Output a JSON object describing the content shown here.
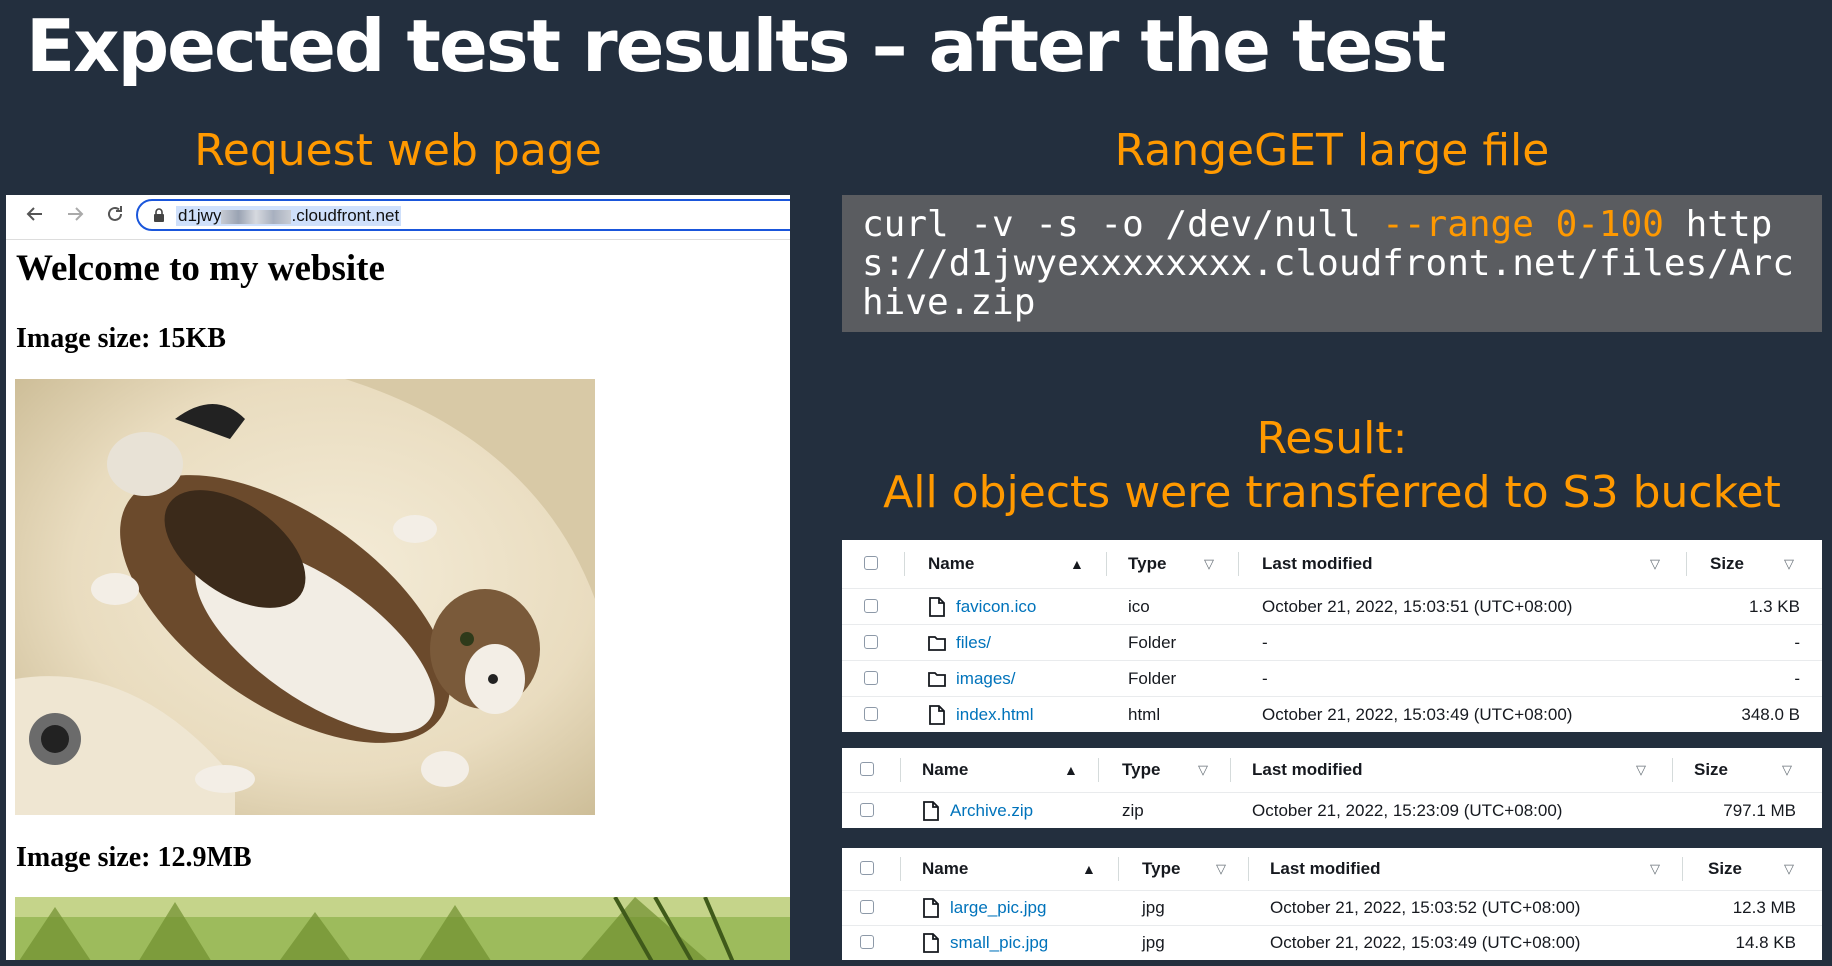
{
  "slide": {
    "title": "Expected test results – after the test",
    "left_heading": "Request web page",
    "right_heading": "RangeGET large file",
    "result_line1": "Result:",
    "result_line2": "All objects were transferred to S3 bucket"
  },
  "browser": {
    "url_prefix": "d1jwy",
    "url_suffix": ".cloudfront.net",
    "page_title": "Welcome to my website",
    "image1_caption": "Image size: 15KB",
    "image2_caption": "Image size: 12.9MB"
  },
  "terminal": {
    "cmd_part1": "curl -v -s -o /dev/null ",
    "cmd_flag": "--range 0-100",
    "cmd_part2": " https://d1jwyexxxxxxxx.cloudfront.net/files/Archive.zip"
  },
  "table_headers": {
    "name": "Name",
    "type": "Type",
    "last_modified": "Last modified",
    "size": "Size"
  },
  "tables": [
    {
      "rows": [
        {
          "name": "favicon.ico",
          "icon": "file-icon",
          "type": "ico",
          "modified": "October 21, 2022, 15:03:51 (UTC+08:00)",
          "size": "1.3 KB"
        },
        {
          "name": "files/",
          "icon": "folder-icon",
          "type": "Folder",
          "modified": "-",
          "size": "-"
        },
        {
          "name": "images/",
          "icon": "folder-icon",
          "type": "Folder",
          "modified": "-",
          "size": "-"
        },
        {
          "name": "index.html",
          "icon": "file-icon",
          "type": "html",
          "modified": "October 21, 2022, 15:03:49 (UTC+08:00)",
          "size": "348.0 B"
        }
      ]
    },
    {
      "rows": [
        {
          "name": "Archive.zip",
          "icon": "file-icon",
          "type": "zip",
          "modified": "October 21, 2022, 15:23:09 (UTC+08:00)",
          "size": "797.1 MB"
        }
      ]
    },
    {
      "rows": [
        {
          "name": "large_pic.jpg",
          "icon": "file-icon",
          "type": "jpg",
          "modified": "October 21, 2022, 15:03:52 (UTC+08:00)",
          "size": "12.3 MB"
        },
        {
          "name": "small_pic.jpg",
          "icon": "file-icon",
          "type": "jpg",
          "modified": "October 21, 2022, 15:03:49 (UTC+08:00)",
          "size": "14.8 KB"
        }
      ]
    }
  ],
  "colors": {
    "background": "#232f3e",
    "accent": "#ff9900",
    "link": "#0073bb",
    "terminal_bg": "#5a5c60"
  }
}
